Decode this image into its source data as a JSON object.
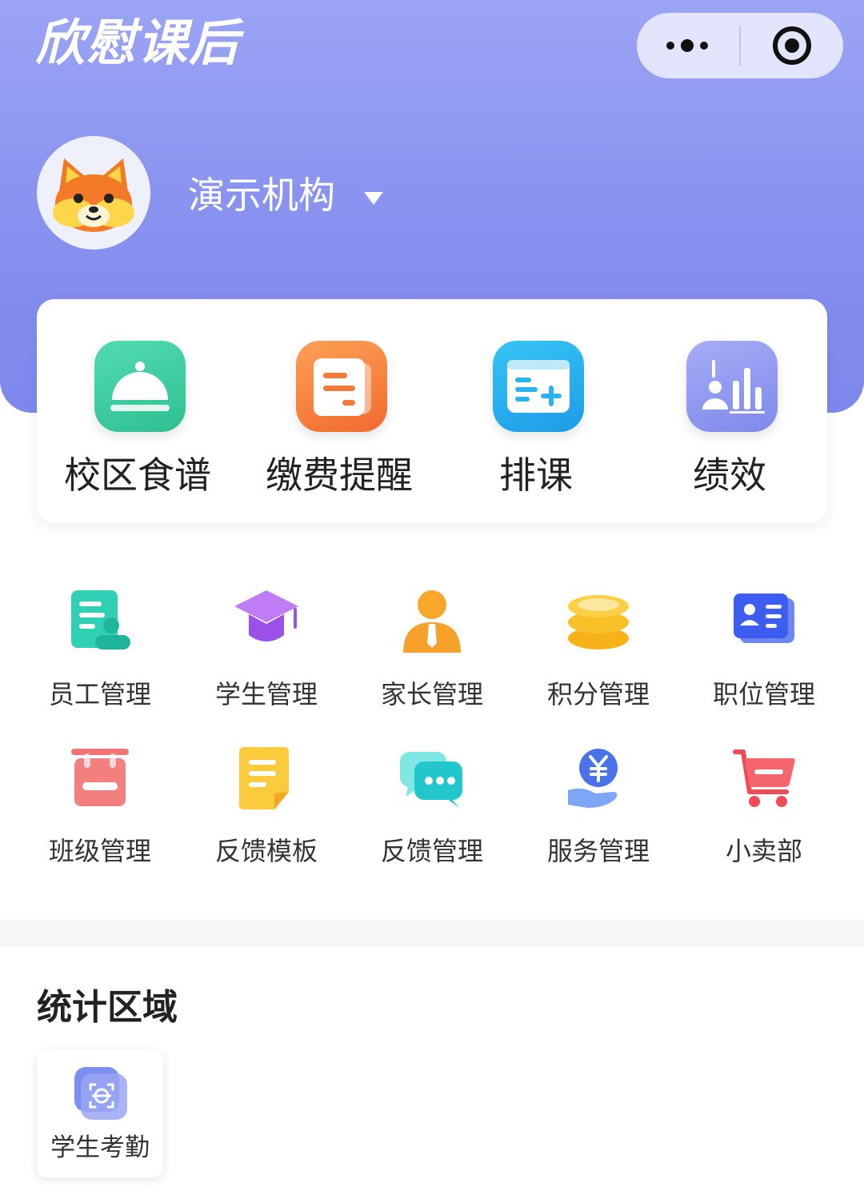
{
  "app": {
    "logo_text": "欣慰课后"
  },
  "capsule": {
    "more_icon": "ellipsis-icon",
    "close_icon": "target-circle-icon"
  },
  "profile": {
    "org_name": "演示机构",
    "avatar_icon": "fox-mascot-icon"
  },
  "quick_actions": [
    {
      "label": "校区食谱",
      "icon": "food-dome-icon",
      "color": "#3cc9a0"
    },
    {
      "label": "缴费提醒",
      "icon": "bill-icon",
      "color": "#f47a3a"
    },
    {
      "label": "排课",
      "icon": "schedule-add-icon",
      "color": "#2ab3f0"
    },
    {
      "label": "绩效",
      "icon": "performance-chart-icon",
      "color": "#8d97ee"
    }
  ],
  "grid": [
    {
      "label": "员工管理",
      "icon": "staff-doc-icon"
    },
    {
      "label": "学生管理",
      "icon": "graduation-cap-icon"
    },
    {
      "label": "家长管理",
      "icon": "parent-person-icon"
    },
    {
      "label": "积分管理",
      "icon": "coin-stack-icon"
    },
    {
      "label": "职位管理",
      "icon": "id-card-icon"
    },
    {
      "label": "班级管理",
      "icon": "class-board-icon"
    },
    {
      "label": "反馈模板",
      "icon": "note-template-icon"
    },
    {
      "label": "反馈管理",
      "icon": "chat-bubbles-icon"
    },
    {
      "label": "服务管理",
      "icon": "yen-hand-icon"
    },
    {
      "label": "小卖部",
      "icon": "shopping-cart-icon"
    }
  ],
  "stats": {
    "title": "统计区域",
    "items": [
      {
        "label": "学生考勤",
        "icon": "face-scan-icon"
      }
    ]
  }
}
